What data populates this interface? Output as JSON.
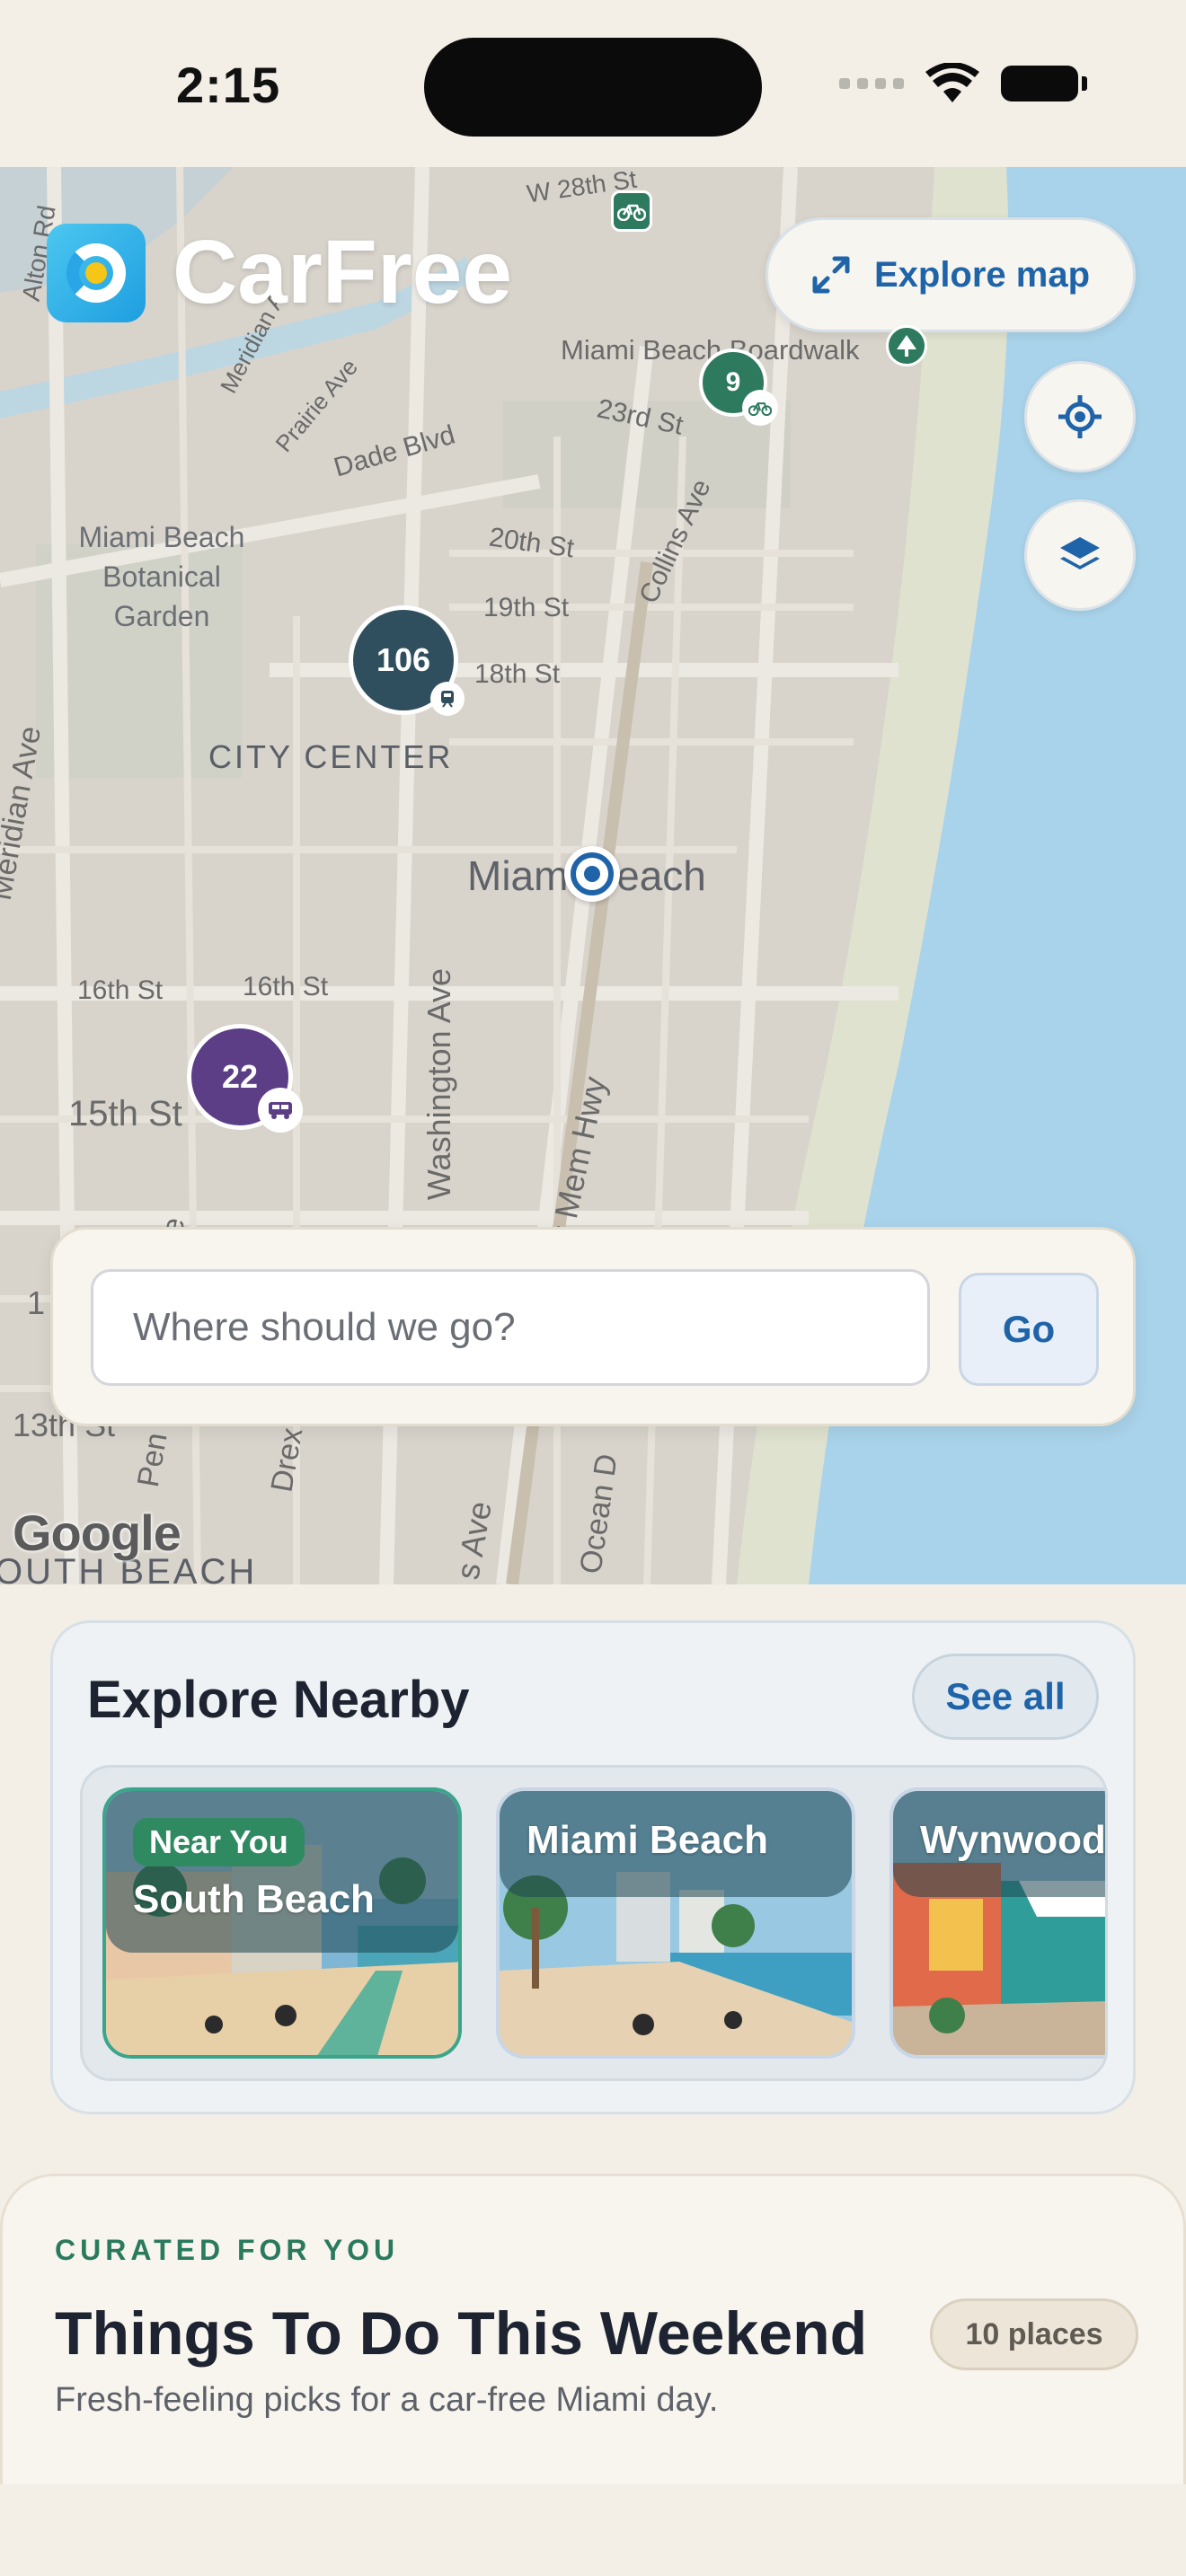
{
  "status_bar": {
    "time": "2:15"
  },
  "app": {
    "name": "CarFree"
  },
  "map": {
    "explore_map_label": "Explore map",
    "attribution": "Google",
    "streets": {
      "w28": "W 28th St",
      "alton": "Alton Rd",
      "boardwalk": "Miami Beach Boardwalk",
      "meridian_a": "Meridian A",
      "prairie": "Prairie Ave",
      "dade": "Dade Blvd",
      "st23": "23rd St",
      "st20": "20th St",
      "st19": "19th St",
      "st18": "18th St",
      "collins": "Collins Ave",
      "meridian": "Meridian Ave",
      "st16a": "16th St",
      "st16b": "16th St",
      "st15": "15th St",
      "washington": "Washington Ave",
      "memhwy": "fett Mem Hwy",
      "st13": "13th St",
      "pen": "Pen",
      "drex": "Drex",
      "ocean": "Ocean D",
      "s_ave": "s Ave",
      "south_beach": "OUTH BEACH",
      "e_ave": "e",
      "one": "1"
    },
    "areas": {
      "garden": "Miami Beach\nBotanical\nGarden",
      "city_center": "CITY CENTER",
      "miami_beach": "Miami Beach"
    },
    "clusters": [
      {
        "count": "106",
        "color": "#2f4f5f",
        "icon": "train-icon"
      },
      {
        "count": "22",
        "color": "#5b3e86",
        "icon": "bus-icon"
      },
      {
        "count": "9",
        "color": "#2d7a5e",
        "icon": "bike-icon"
      }
    ]
  },
  "search": {
    "placeholder": "Where should we go?",
    "go_label": "Go"
  },
  "nearby": {
    "title": "Explore Nearby",
    "see_all": "See all",
    "places": [
      {
        "tag": "Near You",
        "name": "South Beach"
      },
      {
        "name": "Miami Beach"
      },
      {
        "name": "Wynwood"
      }
    ]
  },
  "curated": {
    "eyebrow": "CURATED FOR YOU",
    "title": "Things To Do This Weekend",
    "count": "10 places",
    "subtitle": "Fresh-feeling picks for a car-free Miami day."
  },
  "colors": {
    "accent": "#1f63a8",
    "green": "#2a7a5e",
    "water": "#a9d3ea",
    "beach": "#dfe2cf"
  }
}
